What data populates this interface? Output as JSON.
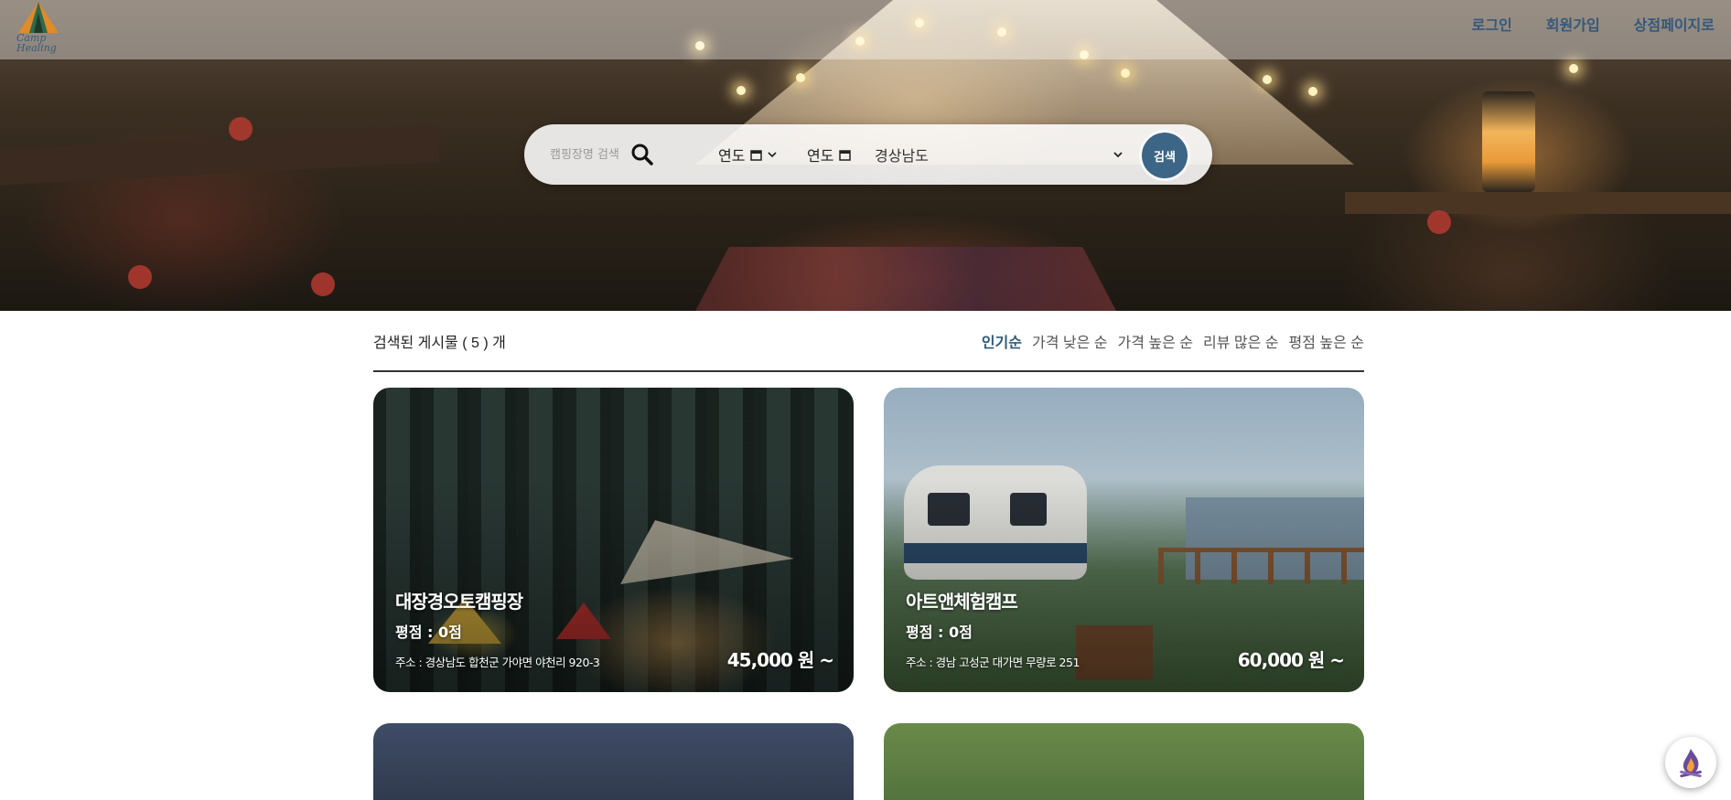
{
  "header": {
    "logo_text": "Camp Healing",
    "nav": [
      "로그인",
      "회원가입",
      "상점페이지로"
    ]
  },
  "search": {
    "keyword_placeholder": "캠핑장명 검색",
    "keyword_value": "",
    "start_date_label": "연도",
    "end_date_label": "연도",
    "region_selected": "경상남도",
    "button_label": "검색"
  },
  "results": {
    "count_text": "검색된 게시물 ( 5 ) 개",
    "sort_options": [
      "인기순",
      "가격 낮은 순",
      "가격 높은 순",
      "리뷰 많은 순",
      "평점 높은 순"
    ],
    "active_sort": "인기순"
  },
  "cards": [
    {
      "name": "대장경오토캠핑장",
      "rating": "평점 : 0점",
      "address": "주소 : 경상남도 합천군 가야면 야천리 920-3",
      "price": "45,000 원 ~"
    },
    {
      "name": "아트앤체험캠프",
      "rating": "평점 : 0점",
      "address": "주소 : 경남 고성군 대가면 무량로 251",
      "price": "60,000 원 ~"
    }
  ],
  "colors": {
    "accent": "#3d6585",
    "nav_text": "#34587a",
    "active_sort": "#2f5a7a"
  }
}
